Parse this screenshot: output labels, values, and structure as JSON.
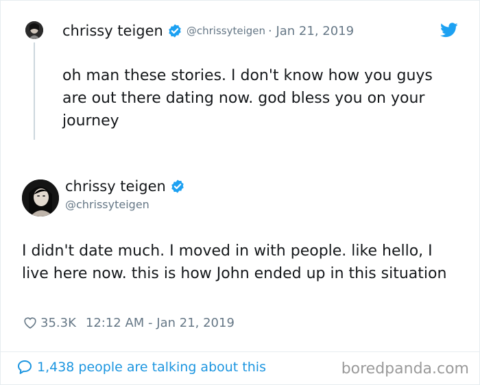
{
  "colors": {
    "text": "#14171a",
    "muted": "#657786",
    "link": "#1b95e0",
    "verified": "#1da1f2",
    "border": "#e6ecf0"
  },
  "reply_tweet": {
    "name": "chrissy teigen",
    "handle": "@chrissyteigen",
    "date": "· Jan 21, 2019",
    "text": "oh man these stories. I don't know how you guys are out there dating now. god bless you on your journey"
  },
  "main_tweet": {
    "name": "chrissy teigen",
    "handle": "@chrissyteigen",
    "text": "I didn't date much. I moved in with people. like hello, I live here now. this is how John ended up in this situation",
    "likes": "35.3K",
    "timestamp": "12:12 AM - Jan 21, 2019"
  },
  "footer": {
    "talking": "1,438 people are talking about this",
    "watermark": "boredpanda.com"
  },
  "icons": [
    "verified-icon",
    "twitter-bird-icon",
    "heart-icon",
    "speech-bubble-icon"
  ]
}
